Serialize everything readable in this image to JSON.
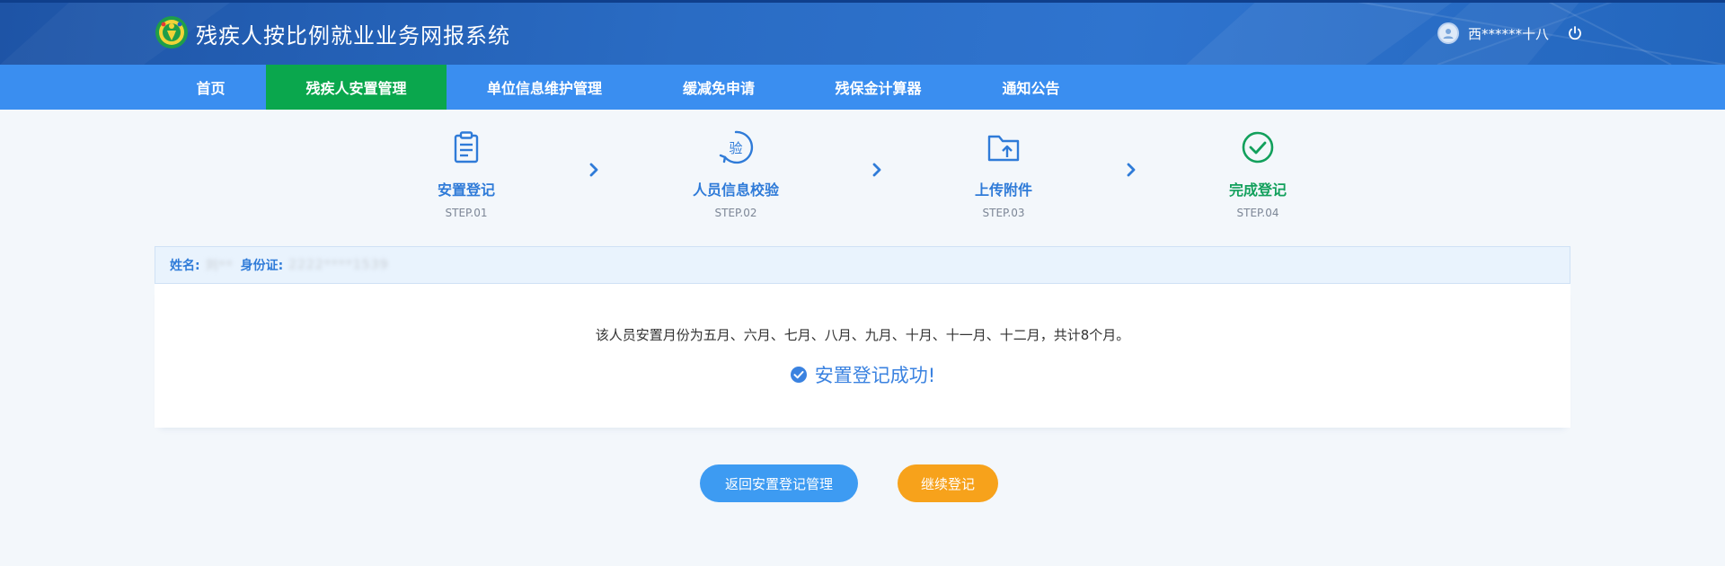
{
  "header": {
    "title": "残疾人按比例就业业务网报系统",
    "user_name": "西******十八",
    "logo_icon": "disability-federation-logo-icon",
    "user_icon": "user-avatar-icon",
    "logout_icon": "power-icon"
  },
  "nav": {
    "items": [
      {
        "label": "首页",
        "active": false
      },
      {
        "label": "残疾人安置管理",
        "active": true
      },
      {
        "label": "单位信息维护管理",
        "active": false
      },
      {
        "label": "缓减免申请",
        "active": false
      },
      {
        "label": "残保金计算器",
        "active": false
      },
      {
        "label": "通知公告",
        "active": false
      }
    ]
  },
  "steps": [
    {
      "label": "安置登记",
      "code": "STEP.01",
      "icon": "clipboard-icon"
    },
    {
      "label": "人员信息校验",
      "code": "STEP.02",
      "icon": "verify-badge-icon"
    },
    {
      "label": "上传附件",
      "code": "STEP.03",
      "icon": "folder-upload-icon"
    },
    {
      "label": "完成登记",
      "code": "STEP.04",
      "icon": "check-circle-icon"
    }
  ],
  "info": {
    "name_label": "姓名:",
    "name_value": "刘**",
    "id_label": "身份证:",
    "id_value": "2222****1539"
  },
  "result": {
    "months_text": "该人员安置月份为五月、六月、七月、八月、九月、十月、十一月、十二月，共计8个月。",
    "success_text": "安置登记成功!"
  },
  "buttons": {
    "back_label": "返回安置登记管理",
    "continue_label": "继续登记"
  },
  "colors": {
    "header": "#2a6cc4",
    "nav": "#3a8ef0",
    "nav_active": "#0aa74d",
    "step": "#2f7bd8",
    "step_done": "#12a05c",
    "btn_back": "#3d9bf2",
    "btn_continue": "#f7a21b"
  }
}
